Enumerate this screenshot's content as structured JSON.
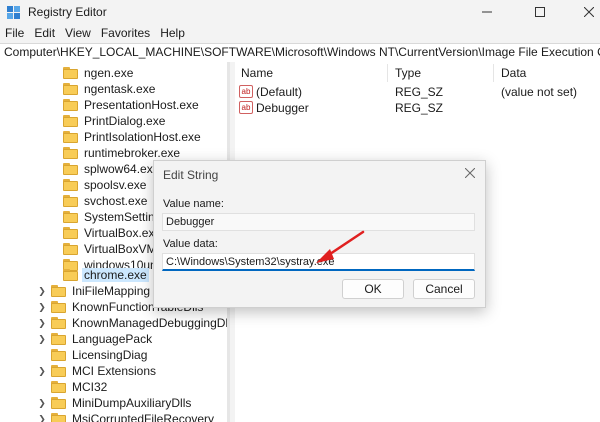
{
  "window": {
    "title": "Registry Editor"
  },
  "menu": [
    "File",
    "Edit",
    "View",
    "Favorites",
    "Help"
  ],
  "address": "Computer\\HKEY_LOCAL_MACHINE\\SOFTWARE\\Microsoft\\Windows NT\\CurrentVersion\\Image File Execution Options\\chrome.exe",
  "tree": {
    "sub_items": [
      "ngen.exe",
      "ngentask.exe",
      "PresentationHost.exe",
      "PrintDialog.exe",
      "PrintIsolationHost.exe",
      "runtimebroker.exe",
      "splwow64.exe",
      "spoolsv.exe",
      "svchost.exe",
      "SystemSettings",
      "VirtualBox.exe",
      "VirtualBoxVM.e",
      "windows10univ",
      "chrome.exe"
    ],
    "selected": "chrome.exe",
    "root_items": [
      "IniFileMapping",
      "KnownFunctionTableDlls",
      "KnownManagedDebuggingDlls",
      "LanguagePack",
      "LicensingDiag",
      "MCI Extensions",
      "MCI32",
      "MiniDumpAuxiliaryDlls",
      "MsiCorruptedFileRecovery"
    ]
  },
  "list": {
    "headers": {
      "name": "Name",
      "type": "Type",
      "data": "Data"
    },
    "rows": [
      {
        "icon": "string-value-icon",
        "name": "(Default)",
        "type": "REG_SZ",
        "data": "(value not set)"
      },
      {
        "icon": "string-value-icon",
        "name": "Debugger",
        "type": "REG_SZ",
        "data": ""
      }
    ]
  },
  "dialog": {
    "title": "Edit String",
    "value_name_label": "Value name:",
    "value_name": "Debugger",
    "value_data_label": "Value data:",
    "value_data": "C:\\Windows\\System32\\systray.exe",
    "ok_label": "OK",
    "cancel_label": "Cancel"
  },
  "annotation": {
    "color": "#e02020"
  }
}
